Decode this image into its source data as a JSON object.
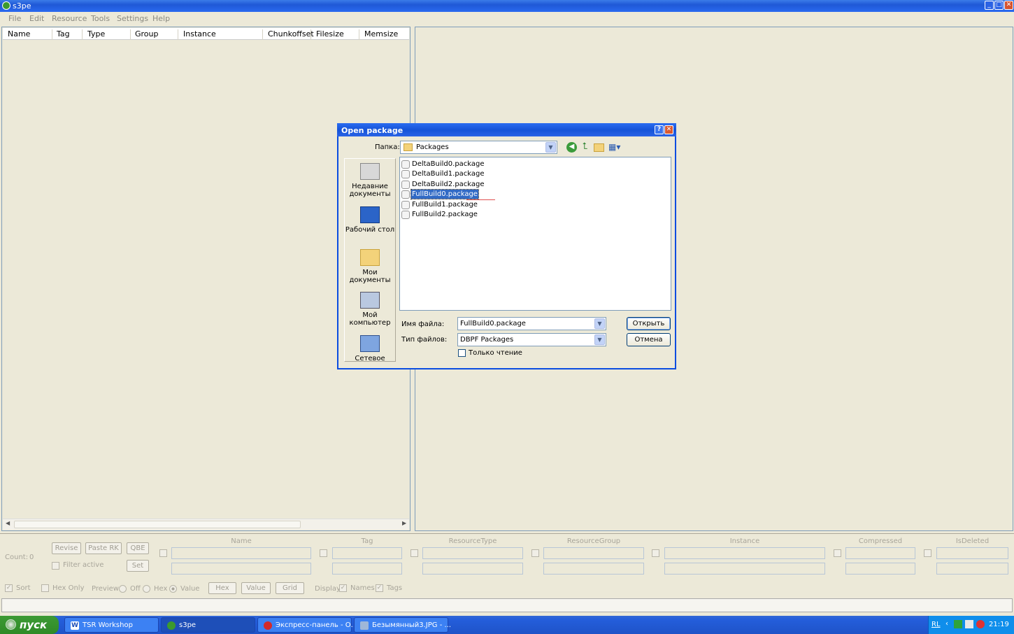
{
  "window": {
    "title": "s3pe"
  },
  "menu": [
    "File",
    "Edit",
    "Resource",
    "Tools",
    "Settings",
    "Help"
  ],
  "list": {
    "columns": [
      "Name",
      "Tag",
      "Type",
      "Group",
      "Instance",
      "Chunkoffset",
      "Filesize",
      "Memsize"
    ]
  },
  "bottom": {
    "count_label": "Count:",
    "count_value": "0",
    "revise": "Revise",
    "paste_rk": "Paste RK",
    "qbe": "QBE",
    "set": "Set",
    "filter_active": "Filter active",
    "headers": [
      "Name",
      "Tag",
      "ResourceType",
      "ResourceGroup",
      "Instance",
      "Compressed",
      "IsDeleted"
    ],
    "sort": "Sort",
    "hex_only": "Hex Only",
    "preview": "Preview:",
    "off": "Off",
    "hex": "Hex",
    "value": "Value",
    "btn_hex": "Hex",
    "btn_value": "Value",
    "btn_grid": "Grid",
    "display": "Display:",
    "names": "Names",
    "tags": "Tags"
  },
  "dialog": {
    "title": "Open package",
    "folder_label": "Папка:",
    "folder_value": "Packages",
    "places": [
      "Недавние документы",
      "Рабочий стол",
      "Мои документы",
      "Мой компьютер",
      "Сетевое"
    ],
    "files": [
      "DeltaBuild0.package",
      "DeltaBuild1.package",
      "DeltaBuild2.package",
      "FullBuild0.package",
      "FullBuild1.package",
      "FullBuild2.package"
    ],
    "selected_file": "FullBuild0.package",
    "filename_label": "Имя файла:",
    "filename_value": "FullBuild0.package",
    "filetype_label": "Тип файлов:",
    "filetype_value": "DBPF Packages",
    "readonly_label": "Только чтение",
    "open": "Открыть",
    "cancel": "Отмена"
  },
  "taskbar": {
    "start": "пуск",
    "tasks": [
      "TSR Workshop",
      "s3pe",
      "Экспресс-панель - О...",
      "Безымянный3.JPG - ..."
    ],
    "lang": "RL",
    "clock": "21:19"
  }
}
